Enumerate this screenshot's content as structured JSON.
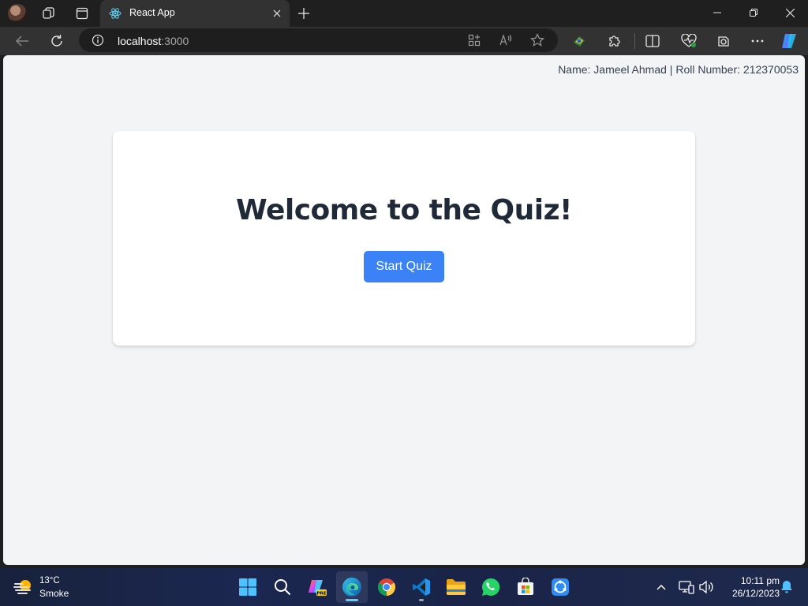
{
  "browser": {
    "tab": {
      "title": "React App"
    },
    "address": {
      "host": "localhost",
      "port": ":3000"
    }
  },
  "page": {
    "author_line": "Name: Jameel Ahmad | Roll Number: 212370053",
    "heading": "Welcome to the Quiz!",
    "start_button": "Start Quiz"
  },
  "taskbar": {
    "weather": {
      "temp": "13°C",
      "condition": "Smoke"
    },
    "clock": {
      "time": "10:11 pm",
      "date": "26/12/2023"
    },
    "pinned_apps": [
      "start-icon",
      "search-icon",
      "copilot-icon",
      "edge-icon",
      "chrome-icon",
      "vscode-icon",
      "file-explorer-icon",
      "whatsapp-icon",
      "microsoft-store-icon",
      "shareit-icon"
    ]
  },
  "colors": {
    "accent_button": "#3b82f6",
    "page_bg": "#f3f4f6",
    "heading": "#1f2937"
  }
}
